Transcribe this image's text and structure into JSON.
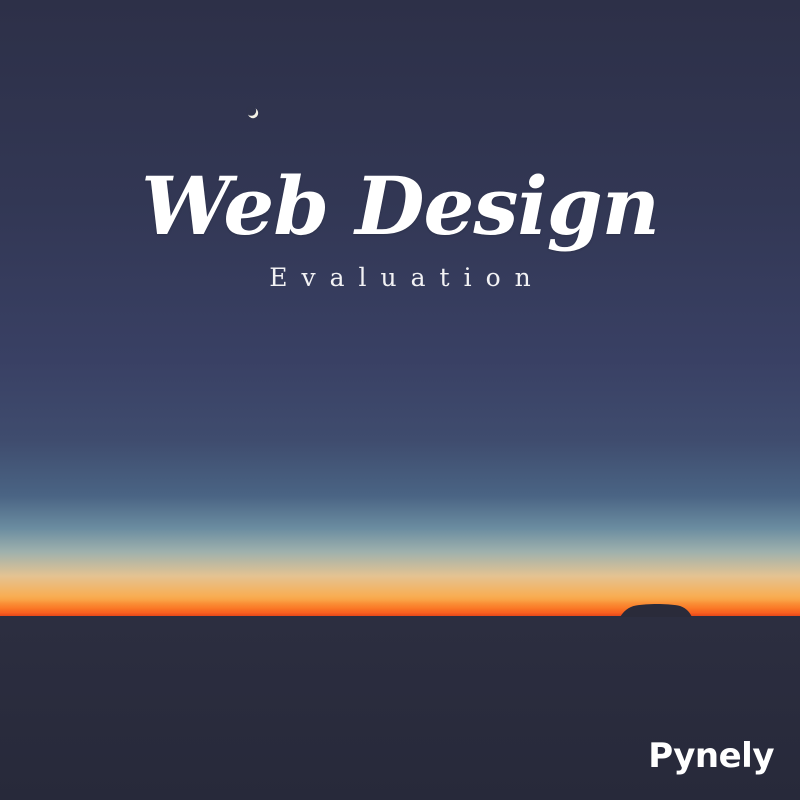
{
  "poster": {
    "title": "Web Design",
    "subtitle": "Evaluation",
    "brand": "Pynely"
  },
  "colors": {
    "sky_top": "#2d3048",
    "sky_mid": "#394064",
    "horizon_orange": "#fc8b2c",
    "horizon_red": "#f3541b",
    "ground": "#27293a",
    "text": "#ffffff"
  },
  "icons": {
    "moon": "crescent-moon-icon",
    "rock": "rock-silhouette"
  }
}
